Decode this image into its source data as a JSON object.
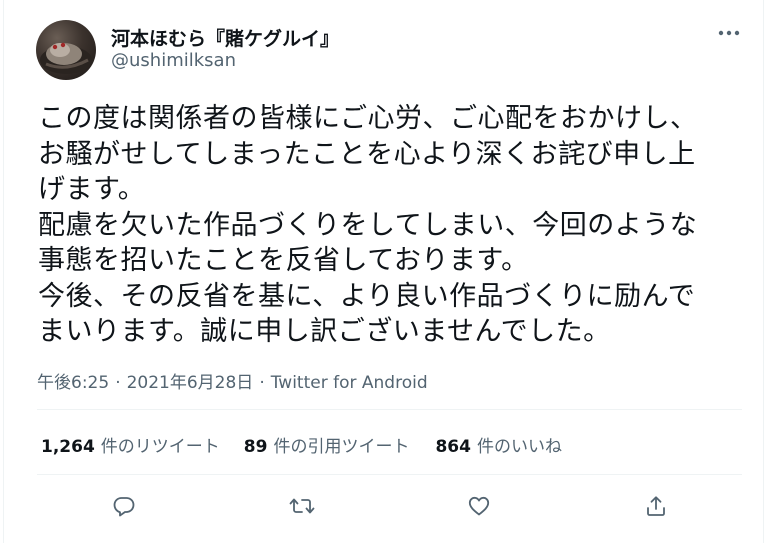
{
  "tweet": {
    "author": {
      "display_name": "河本ほむら『賭ケグルイ』",
      "handle": "@ushimilksan"
    },
    "text_lines": [
      "この度は関係者の皆様にご心労、ご心配をおかけし、",
      "お騒がせしてしまったことを心より深くお詫び申し上",
      "げます。",
      "配慮を欠いた作品づくりをしてしまい、今回のような",
      "事態を招いたことを反省しております。",
      "今後、その反省を基に、より良い作品づくりに励んで",
      "まいります。誠に申し訳ございませんでした。"
    ],
    "time": "午後6:25",
    "date": "2021年6月28日",
    "separator": "·",
    "source": "Twitter for Android",
    "stats": {
      "retweets": {
        "count": "1,264",
        "label": "件のリツイート"
      },
      "quotes": {
        "count": "89",
        "label": "件の引用ツイート"
      },
      "likes": {
        "count": "864",
        "label": "件のいいね"
      }
    }
  },
  "icons": {
    "more": "more-horizontal-icon",
    "reply": "reply-icon",
    "retweet": "retweet-icon",
    "like": "heart-icon",
    "share": "share-icon"
  },
  "colors": {
    "text_primary": "#0f1419",
    "text_secondary": "#536471",
    "divider": "#eff3f4"
  }
}
